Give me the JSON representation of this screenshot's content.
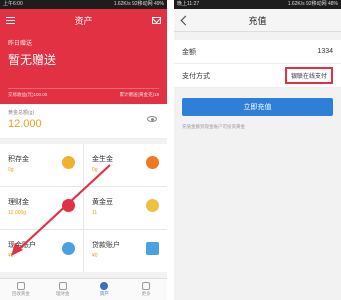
{
  "left": {
    "status": {
      "left": "上午6:00",
      "right": "1.62K/s 92移动网 49%"
    },
    "title": "资产",
    "banner": {
      "sub": "昨日赠送",
      "main": "暂无赠送",
      "stat1": "交易收益(元)100.00",
      "stat2": "累计赠送(黄金克)18"
    },
    "balance": {
      "label": "黄金总额(g)",
      "value": "12.000"
    },
    "cells": [
      {
        "title": "积存金",
        "sub": "0g",
        "color": "#f0b030"
      },
      {
        "title": "金生金",
        "sub": "0g",
        "color": "#f07820"
      },
      {
        "title": "理财金",
        "sub": "12.000g",
        "color": "#e23142"
      },
      {
        "title": "黄金豆",
        "sub": "11",
        "color": "#f0c040"
      },
      {
        "title": "现金账户",
        "sub": "¥0",
        "color": "#4aa0e0"
      },
      {
        "title": "贷款账户",
        "sub": "¥0",
        "color": "#4aa0e0"
      }
    ],
    "tabs": [
      {
        "label": "回收黄金"
      },
      {
        "label": "理财金"
      },
      {
        "label": "资产"
      },
      {
        "label": "更多"
      }
    ],
    "accent_color": "#e23142"
  },
  "right": {
    "status": {
      "left": "晚上11:27",
      "right": "1.62K/s 92移动网 48%"
    },
    "title": "充值",
    "amount": {
      "label": "金额",
      "value": "1334"
    },
    "method": {
      "label": "支付方式",
      "value": "银联在线支付"
    },
    "submit_label": "立即充值",
    "hint": "充值金额到现金账户可投资黄金",
    "button_color": "#2f7fd9"
  }
}
